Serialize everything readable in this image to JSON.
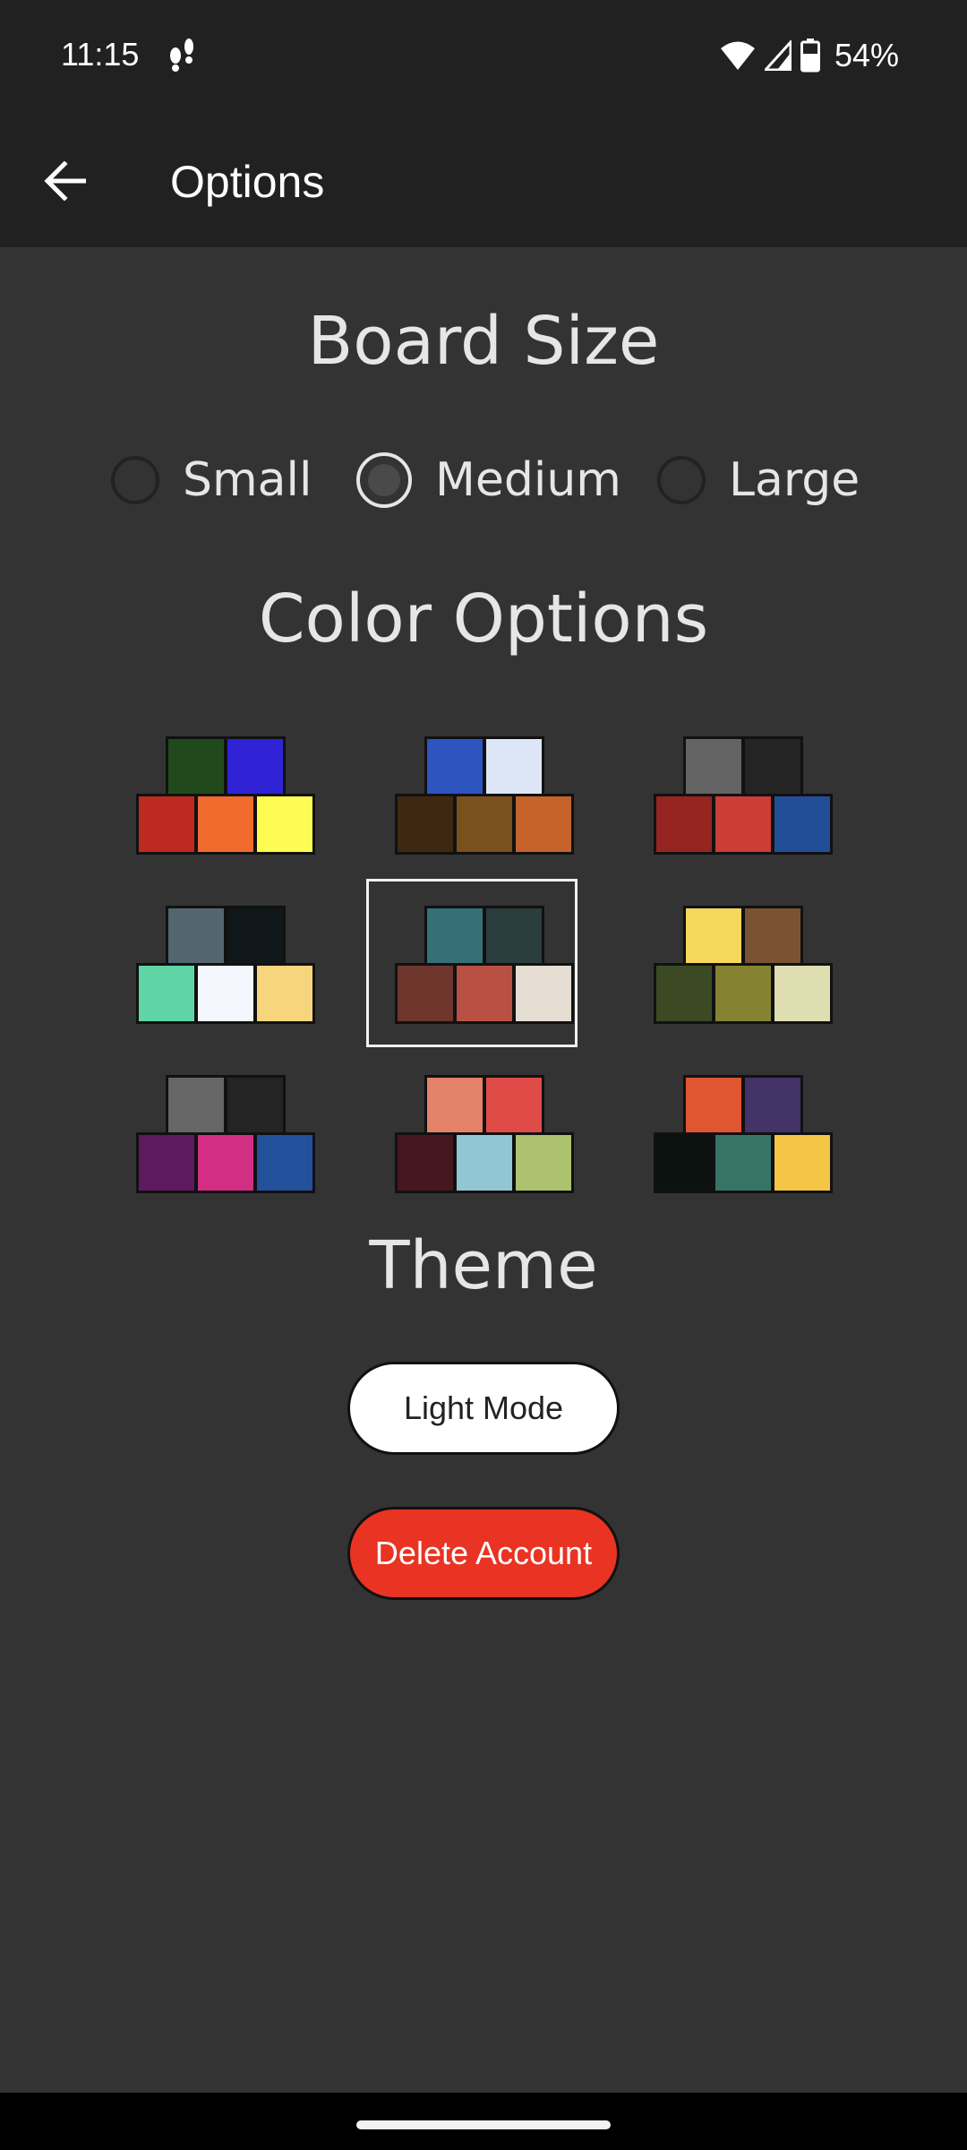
{
  "status_bar": {
    "time": "11:15",
    "battery": "54%",
    "icons": [
      "footsteps-icon",
      "wifi-icon",
      "cellular-signal-icon",
      "battery-icon"
    ]
  },
  "app_bar": {
    "title": "Options",
    "back_icon": "arrow-back-icon"
  },
  "board_size": {
    "title": "Board Size",
    "options": [
      "Small",
      "Medium",
      "Large"
    ],
    "selected": "Medium"
  },
  "color_options": {
    "title": "Color Options",
    "selected_index": 4,
    "palettes": [
      {
        "top": [
          "#214a1c",
          "#3023d6"
        ],
        "bottom": [
          "#bd2a1f",
          "#f06b2d",
          "#fdfc52"
        ]
      },
      {
        "top": [
          "#2e54c0",
          "#dce6f6"
        ],
        "bottom": [
          "#3f2812",
          "#7a501d",
          "#c5632a"
        ]
      },
      {
        "top": [
          "#636363",
          "#242424"
        ],
        "bottom": [
          "#962420",
          "#cc3d37",
          "#224e98"
        ]
      },
      {
        "top": [
          "#53666f",
          "#0f171b"
        ],
        "bottom": [
          "#5fd5a6",
          "#f5f7fe",
          "#f7d57c"
        ]
      },
      {
        "top": [
          "#357077",
          "#2b3d3c"
        ],
        "bottom": [
          "#6f362d",
          "#b85143",
          "#e5dcd2"
        ]
      },
      {
        "top": [
          "#f4d75b",
          "#7a5332"
        ],
        "bottom": [
          "#3b4a23",
          "#858331",
          "#dfdeb1"
        ]
      },
      {
        "top": [
          "#666666",
          "#242424"
        ],
        "bottom": [
          "#5d1b5d",
          "#d12e84",
          "#22509a"
        ]
      },
      {
        "top": [
          "#e38169",
          "#df4c47"
        ],
        "bottom": [
          "#451820",
          "#93c6d5",
          "#adc26f"
        ]
      },
      {
        "top": [
          "#e05631",
          "#433366"
        ],
        "bottom": [
          "#0b1210",
          "#377468",
          "#f5c545"
        ]
      }
    ]
  },
  "theme": {
    "title": "Theme",
    "light_mode_label": "Light Mode",
    "delete_account_label": "Delete Account"
  },
  "colors": {
    "background": "#333333",
    "bar": "#212121",
    "delete": "#e93323"
  }
}
